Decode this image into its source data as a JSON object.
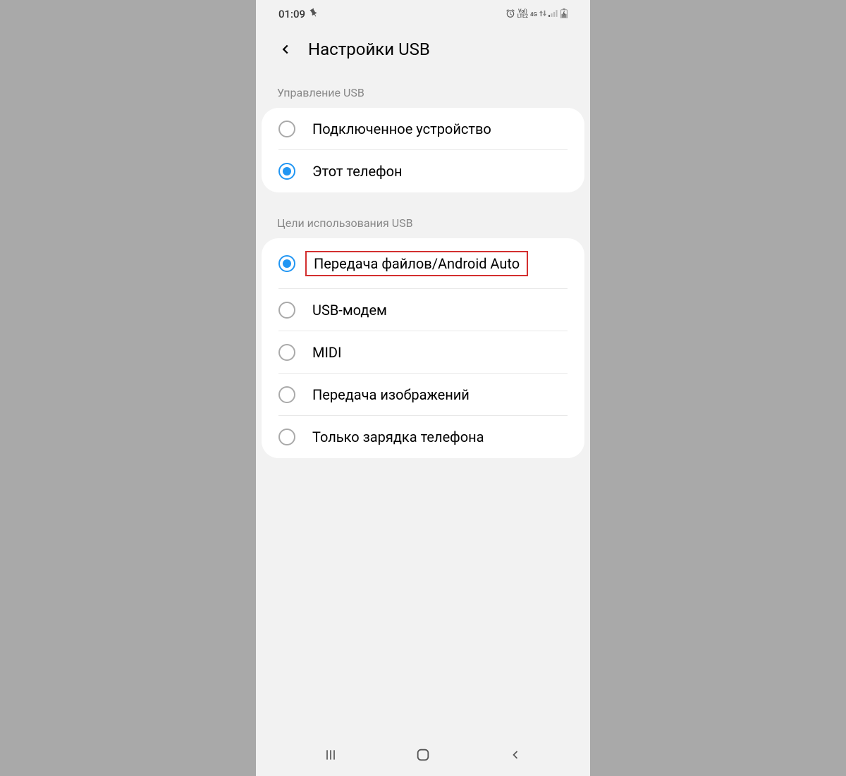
{
  "status_bar": {
    "time": "01:09",
    "vo_lte": "VoI\nLTE2",
    "network": "4G"
  },
  "header": {
    "title": "Настройки USB"
  },
  "sections": {
    "control": {
      "label": "Управление USB",
      "options": [
        {
          "label": "Подключенное устройство",
          "selected": false
        },
        {
          "label": "Этот телефон",
          "selected": true
        }
      ]
    },
    "purpose": {
      "label": "Цели использования USB",
      "options": [
        {
          "label": "Передача файлов/Android Auto",
          "selected": true,
          "highlighted": true
        },
        {
          "label": "USB-модем",
          "selected": false
        },
        {
          "label": "MIDI",
          "selected": false
        },
        {
          "label": "Передача изображений",
          "selected": false
        },
        {
          "label": "Только зарядка телефона",
          "selected": false
        }
      ]
    }
  }
}
